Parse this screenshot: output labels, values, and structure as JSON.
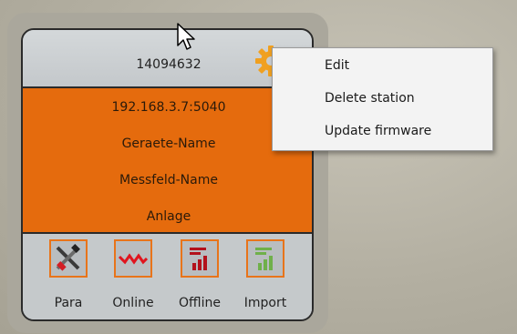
{
  "station": {
    "id": "14094632",
    "address": "192.168.3.7:5040",
    "device_name": "Geraete-Name",
    "field_name": "Messfeld-Name",
    "plant": "Anlage"
  },
  "toolbar": {
    "items": [
      {
        "label": "Para",
        "icon": "para-tools-icon"
      },
      {
        "label": "Online",
        "icon": "online-wave-icon"
      },
      {
        "label": "Offline",
        "icon": "offline-bars-icon"
      },
      {
        "label": "Import",
        "icon": "import-bars-icon"
      }
    ]
  },
  "context_menu": {
    "items": [
      {
        "label": "Edit"
      },
      {
        "label": "Delete station"
      },
      {
        "label": "Update firmware"
      }
    ]
  },
  "colors": {
    "accent_orange": "#e56b0d",
    "card_gray": "#c7cbcd",
    "online_red": "#e0141e",
    "offline_red": "#b3121c",
    "import_green": "#6fb04a"
  }
}
